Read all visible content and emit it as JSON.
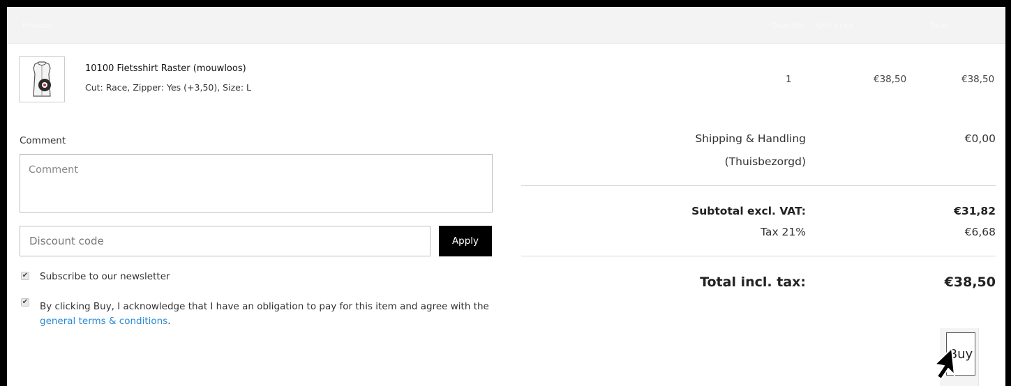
{
  "header": {
    "col_product": "Product",
    "col_quantity": "Quantity",
    "col_price": "Unit price",
    "col_total": "Total"
  },
  "item": {
    "name": "10100 Fietsshirt Raster (mouwloos)",
    "options": "Cut: Race, Zipper: Yes (+3,50), Size: L",
    "quantity": "1",
    "unit_price": "€38,50",
    "line_total": "€38,50",
    "thumbnail_icon": "cycling-vest-thumbnail-icon"
  },
  "form": {
    "comment_label": "Comment",
    "comment_placeholder": "Comment",
    "discount_placeholder": "Discount code",
    "apply_label": "Apply",
    "newsletter_label": "Subscribe to our newsletter",
    "newsletter_checked": true,
    "terms_text": "By clicking Buy, I acknowledge that I have an obligation to pay for this item and agree with the",
    "terms_link": "general terms & conditions",
    "terms_end": ".",
    "terms_checked": true
  },
  "totals": {
    "shipping_label": "Shipping & Handling",
    "shipping_method": "(Thuisbezorgd)",
    "shipping_value": "€0,00",
    "subtotal_label": "Subtotal excl. VAT:",
    "subtotal_value": "€31,82",
    "tax_label": "Tax 21%",
    "tax_value": "€6,68",
    "total_label": "Total incl. tax:",
    "total_value": "€38,50"
  },
  "buy_label": "Buy",
  "colors": {
    "link": "#2a8ad4",
    "apply_bg": "#000000",
    "header_bg": "#f3f3f3"
  }
}
